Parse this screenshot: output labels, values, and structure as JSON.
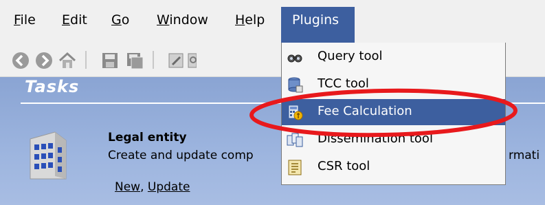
{
  "menubar": {
    "items": [
      {
        "accel": "F",
        "rest": "ile"
      },
      {
        "accel": "E",
        "rest": "dit"
      },
      {
        "accel": "G",
        "rest": "o"
      },
      {
        "accel": "W",
        "rest": "indow"
      },
      {
        "accel": "H",
        "rest": "elp"
      }
    ],
    "plugins_label": "Plugins"
  },
  "toolbar": {
    "icons": [
      "back-icon",
      "forward-icon",
      "home-icon",
      "save-icon",
      "save-all-icon",
      "edit-icon",
      "preview-icon",
      "redo-icon"
    ]
  },
  "tasks": {
    "title": "Tasks",
    "entity_title": "Legal entity",
    "entity_desc": "Create and update comp",
    "entity_desc_tail": "rmati",
    "link_new": "New",
    "link_sep": ",",
    "link_update": "Update"
  },
  "plugins_menu": {
    "items": [
      {
        "label": "Query tool",
        "icon": "binoculars-icon"
      },
      {
        "label": "TCC tool",
        "icon": "database-icon"
      },
      {
        "label": "Fee Calculation",
        "icon": "fee-calculator-icon",
        "selected": true
      },
      {
        "label": "Dissemination tool",
        "icon": "dissemination-icon"
      },
      {
        "label": "CSR tool",
        "icon": "document-list-icon"
      }
    ]
  },
  "colors": {
    "highlight": "#3d5f9f",
    "annotation_ellipse": "#e8191c",
    "content_bg": "#9db5df"
  }
}
